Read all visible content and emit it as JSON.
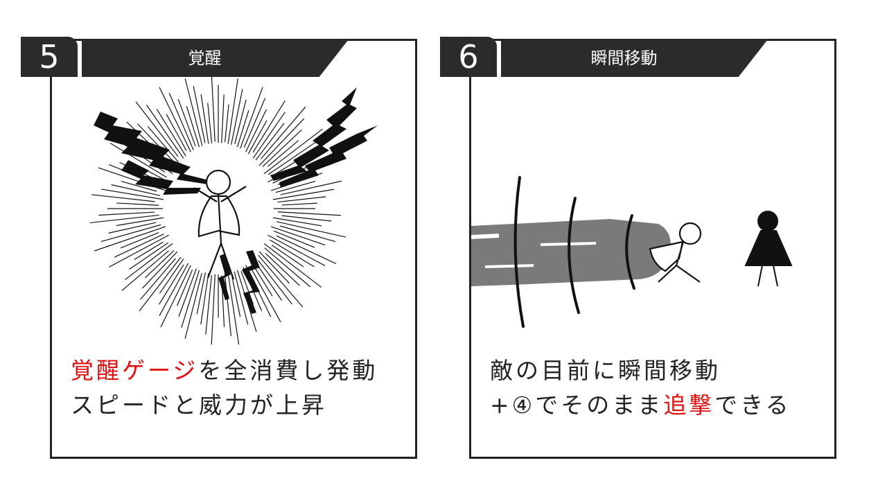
{
  "cards": [
    {
      "number": "5",
      "title": "覚醒",
      "caption_line1": {
        "highlight": "覚醒ゲージ",
        "rest": "を全消費し発動"
      },
      "caption_line2": "スピードと威力が上昇"
    },
    {
      "number": "6",
      "title": "瞬間移動",
      "caption_line1": "敵の目前に瞬間移動",
      "caption_line2": {
        "before": "+④でそのまま",
        "highlight": "追撃",
        "after": "できる"
      }
    }
  ],
  "colors": {
    "highlight": "#e01010",
    "tab": "#2b2b2b",
    "border": "#222222"
  }
}
